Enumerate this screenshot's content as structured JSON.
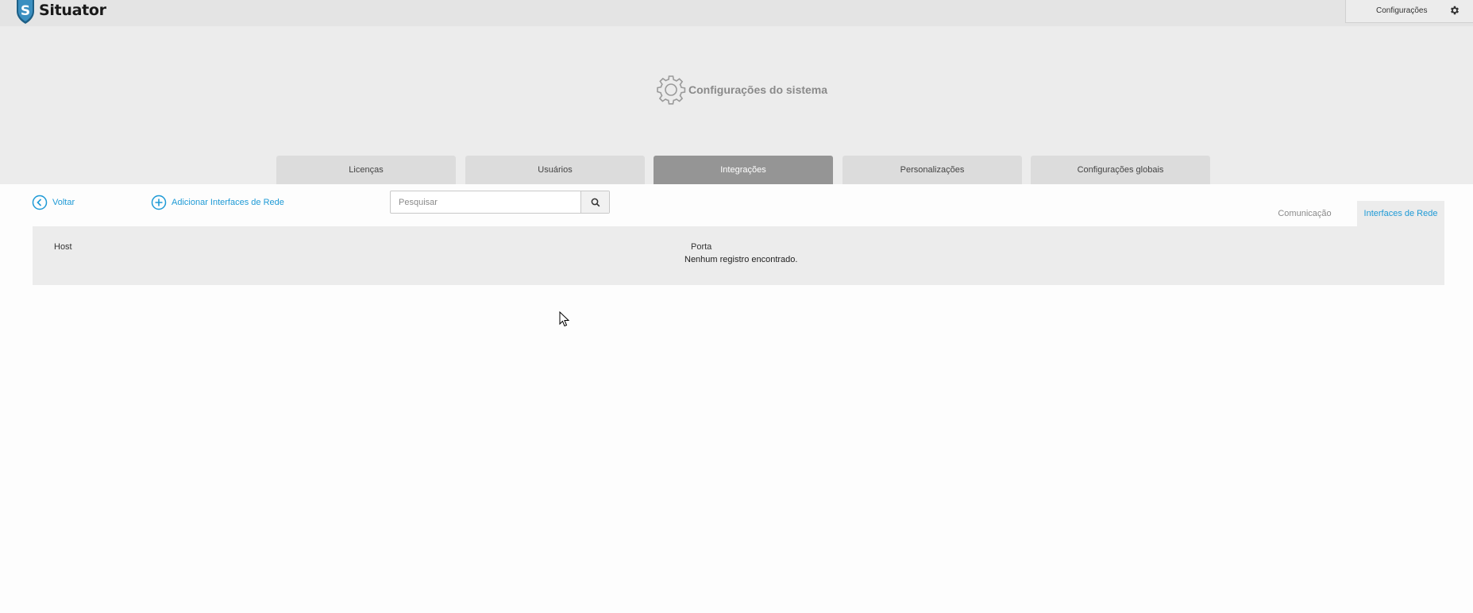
{
  "app": {
    "name": "Situator",
    "logo_letter": "S",
    "config_button_label": "Configurações"
  },
  "page": {
    "title": "Configurações do sistema"
  },
  "tabs": [
    {
      "label": "Licenças",
      "active": false
    },
    {
      "label": "Usuários",
      "active": false
    },
    {
      "label": "Integrações",
      "active": true
    },
    {
      "label": "Personalizações",
      "active": false
    },
    {
      "label": "Configurações globais",
      "active": false
    }
  ],
  "toolbar": {
    "back_label": "Voltar",
    "add_label": "Adicionar Interfaces de Rede",
    "search_placeholder": "Pesquisar"
  },
  "subtabs": [
    {
      "label": "Comunicação",
      "active": false
    },
    {
      "label": "Interfaces de Rede",
      "active": true
    }
  ],
  "table": {
    "columns": [
      "Host",
      "Porta"
    ],
    "empty_message": "Nenhum registro encontrado."
  },
  "colors": {
    "accent": "#1e9ad6",
    "active_tab": "#959595",
    "header_bg": "#ececec",
    "logo_shield": "#1d5f86"
  },
  "icons": [
    "shield-logo-icon",
    "gear-icon",
    "settings-cog-icon",
    "back-arrow-icon",
    "add-icon",
    "search-icon",
    "mouse-cursor-icon"
  ]
}
